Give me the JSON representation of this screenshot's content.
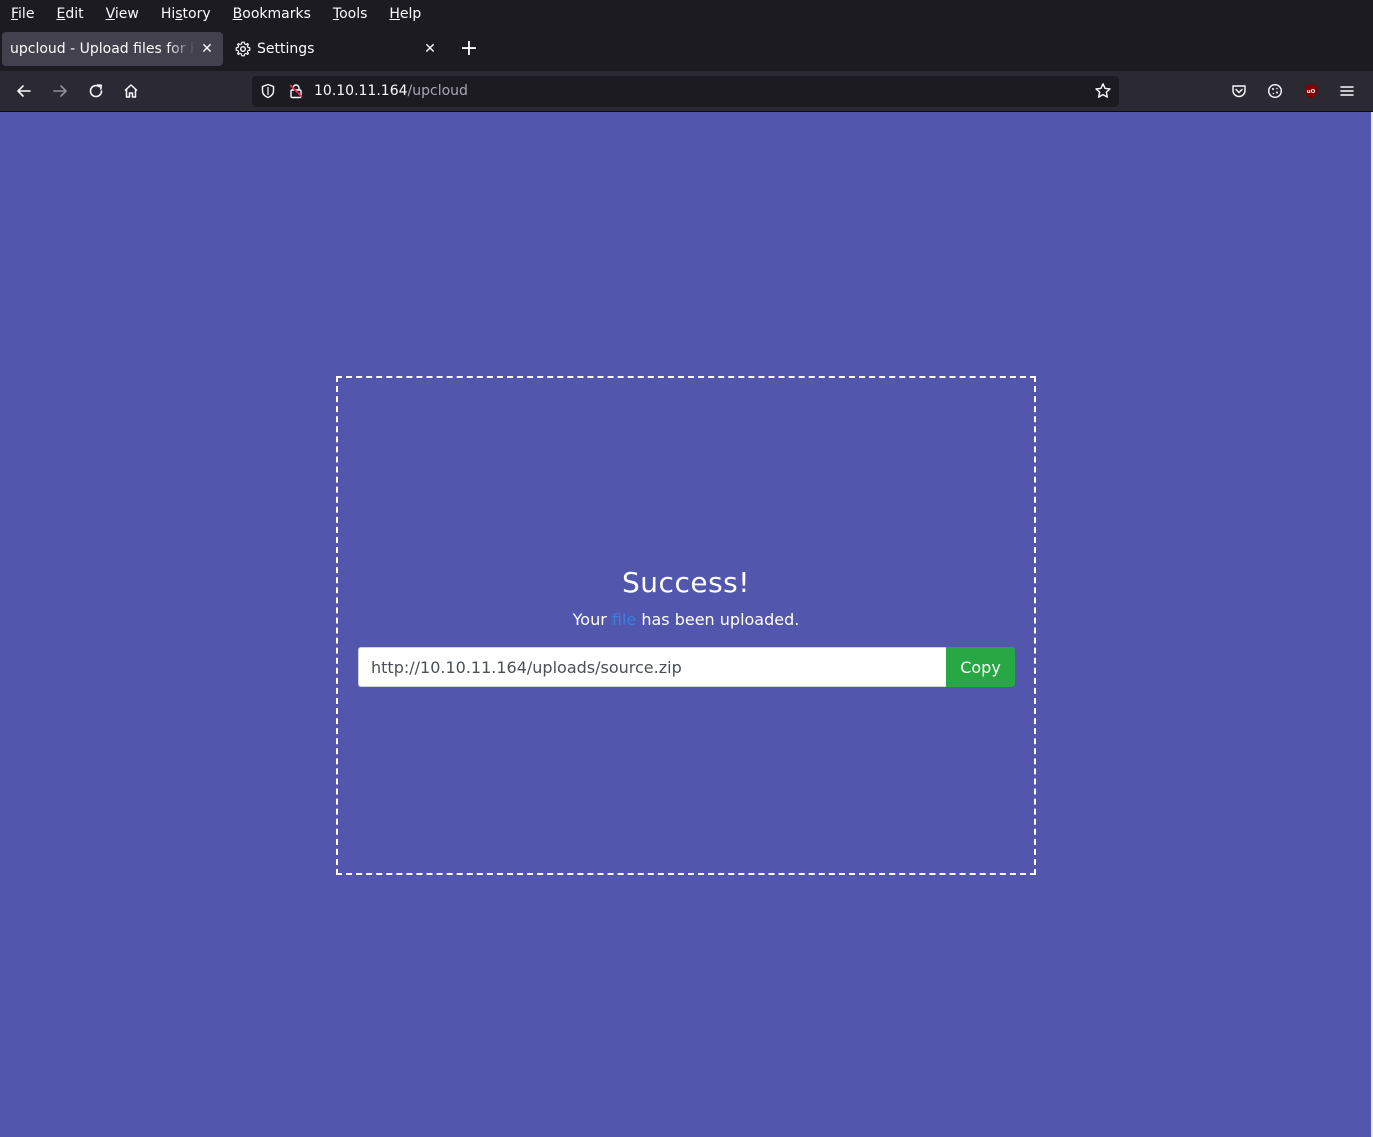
{
  "browser": {
    "menu": {
      "file": {
        "pre": "",
        "ul": "F",
        "post": "ile"
      },
      "edit": {
        "pre": "",
        "ul": "E",
        "post": "dit"
      },
      "view": {
        "pre": "",
        "ul": "V",
        "post": "iew"
      },
      "history": {
        "pre": "Hi",
        "ul": "s",
        "post": "tory"
      },
      "bookmarks": {
        "pre": "",
        "ul": "B",
        "post": "ookmarks"
      },
      "tools": {
        "pre": "",
        "ul": "T",
        "post": "ools"
      },
      "help": {
        "pre": "",
        "ul": "H",
        "post": "elp"
      }
    },
    "tabs": [
      {
        "title": "upcloud - Upload files for Free!",
        "active": true
      },
      {
        "title": "Settings",
        "active": false
      }
    ],
    "newtab_label": "+",
    "close_glyph": "✕",
    "url": {
      "host": "10.10.11.164",
      "path": "/upcloud"
    },
    "icons": [
      "back-icon",
      "forward-icon",
      "reload-icon",
      "home-icon",
      "shield-icon",
      "lock-icon",
      "star-icon",
      "pocket-icon",
      "cookie-icon",
      "ublock-icon",
      "hamburger-menu-icon",
      "gear-icon"
    ]
  },
  "page": {
    "background": "#5257ad",
    "success_title": "Success!",
    "message_prefix": "Your ",
    "message_link": "file",
    "message_suffix": " has been uploaded.",
    "upload_url": "http://10.10.11.164/uploads/source.zip",
    "copy_label": "Copy",
    "copy_color": "#28a745"
  }
}
